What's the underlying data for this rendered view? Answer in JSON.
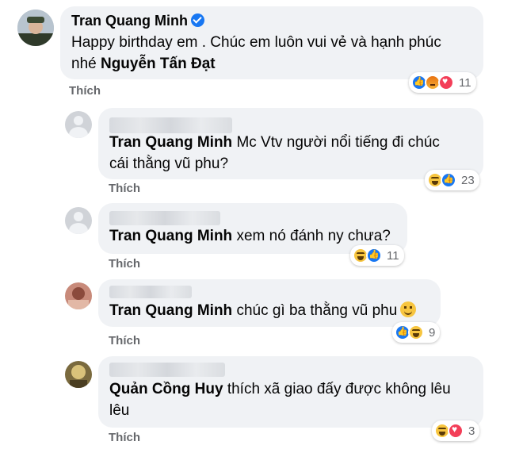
{
  "main_comment": {
    "author": "Tran Quang Minh",
    "text_part1": "Happy birthday em . Chúc em luôn vui vẻ và hạnh phúc",
    "text_part2_prefix": "nhé ",
    "mention": "Nguyễn Tấn Đạt",
    "like_label": "Thích",
    "reaction_icons": [
      "like-icon",
      "angry-icon",
      "love-icon"
    ],
    "reaction_count": "11"
  },
  "replies": [
    {
      "tag": "Tran Quang Minh",
      "text_line1": " Mc Vtv người nổi tiếng đi chúc",
      "text_line2": "cái thằng vũ phu?",
      "like_label": "Thích",
      "reaction_icons": [
        "haha-icon",
        "like-icon"
      ],
      "reaction_count": "23"
    },
    {
      "tag": "Tran Quang Minh",
      "text": " xem nó đánh ny chưa?",
      "like_label": "Thích",
      "reaction_icons": [
        "haha-icon",
        "like-icon"
      ],
      "reaction_count": "11"
    },
    {
      "tag": "Tran Quang Minh",
      "text": " chúc gì ba thằng vũ phu",
      "emoji": "smile-emoji",
      "like_label": "Thích",
      "reaction_icons": [
        "like-icon",
        "haha-icon"
      ],
      "reaction_count": "9"
    },
    {
      "tag": "Quản Cồng Huy",
      "text_line1": " thích xã giao đấy được không lêu",
      "text_line2": "lêu",
      "like_label": "Thích",
      "reaction_icons": [
        "haha-icon",
        "love-icon"
      ],
      "reaction_count": "3"
    }
  ],
  "colors": {
    "bubble": "#f0f2f5",
    "secondary_text": "#65676b",
    "verified_blue": "#1877f2"
  }
}
